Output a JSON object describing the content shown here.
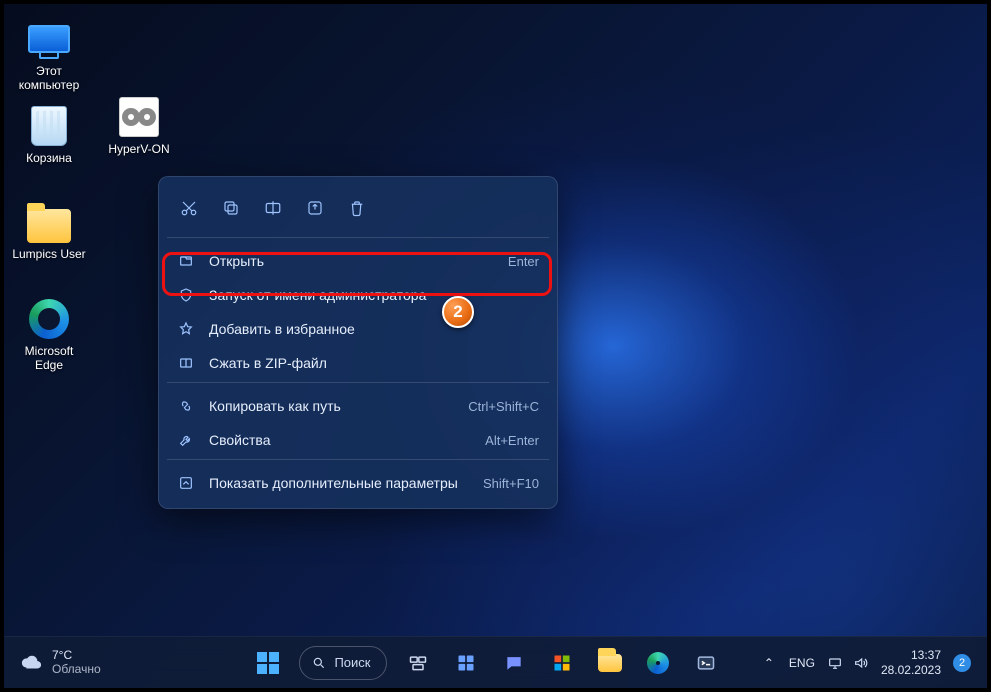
{
  "desktop": {
    "icons": [
      {
        "name": "this-pc",
        "label": "Этот\nкомпьютер"
      },
      {
        "name": "recycle-bin",
        "label": "Корзина"
      },
      {
        "name": "hyperv-on",
        "label": "HyperV-ON"
      },
      {
        "name": "lumpics-user",
        "label": "Lumpics User"
      },
      {
        "name": "microsoft-edge",
        "label": "Microsoft\nEdge"
      }
    ]
  },
  "context_menu": {
    "icon_row": [
      "cut",
      "copy",
      "rename",
      "share",
      "delete"
    ],
    "items": [
      {
        "icon": "open",
        "label": "Открыть",
        "shortcut": "Enter"
      },
      {
        "icon": "admin",
        "label": "Запуск от имени администратора",
        "shortcut": ""
      },
      {
        "icon": "star",
        "label": "Добавить в избранное",
        "shortcut": ""
      },
      {
        "icon": "zip",
        "label": "Сжать в ZIP-файл",
        "shortcut": ""
      },
      {
        "icon": "copy-path",
        "label": "Копировать как путь",
        "shortcut": "Ctrl+Shift+C"
      },
      {
        "icon": "properties",
        "label": "Свойства",
        "shortcut": "Alt+Enter"
      },
      {
        "icon": "more",
        "label": "Показать дополнительные параметры",
        "shortcut": "Shift+F10"
      }
    ],
    "highlight_index": 1,
    "callout": "2"
  },
  "taskbar": {
    "weather": {
      "temp": "7°C",
      "desc": "Облачно"
    },
    "search_label": "Поиск",
    "lang": "ENG",
    "time": "13:37",
    "date": "28.02.2023",
    "notifications": "2"
  }
}
